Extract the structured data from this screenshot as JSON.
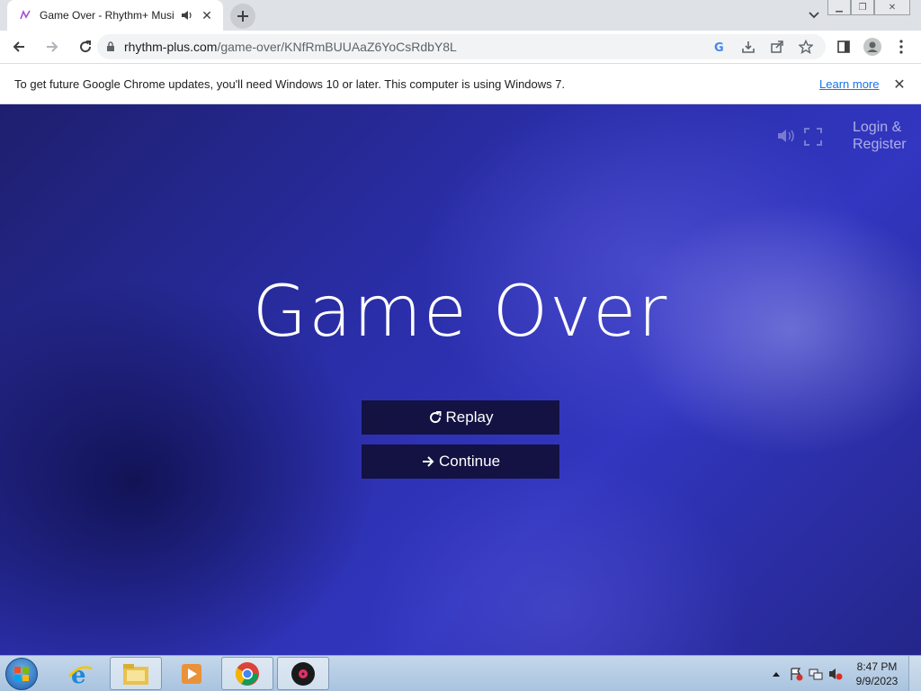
{
  "tab": {
    "title": "Game Over - Rhythm+ Musi",
    "favicon": "rhythm-plus-favicon",
    "audio_icon": "speaker-icon",
    "close_label": "✕"
  },
  "window": {
    "minimize_label": "▁",
    "restore_label": "❐",
    "close_label": "✕"
  },
  "toolbar": {
    "url_host": "rhythm-plus.com",
    "url_path": "/game-over/KNfRmBUUAaZ6YoCsRdbY8L"
  },
  "infobar": {
    "text": "To get future Google Chrome updates, you'll need Windows 10 or later. This computer is using Windows 7.",
    "link": "Learn more",
    "close_label": "✕"
  },
  "page": {
    "login_line1": "Login &",
    "login_line2": "Register",
    "heading": "Game Over",
    "replay_label": "Replay",
    "continue_label": "Continue",
    "background_color": "#2a2ea8"
  },
  "taskbar": {
    "time": "8:47 PM",
    "date": "9/9/2023"
  }
}
